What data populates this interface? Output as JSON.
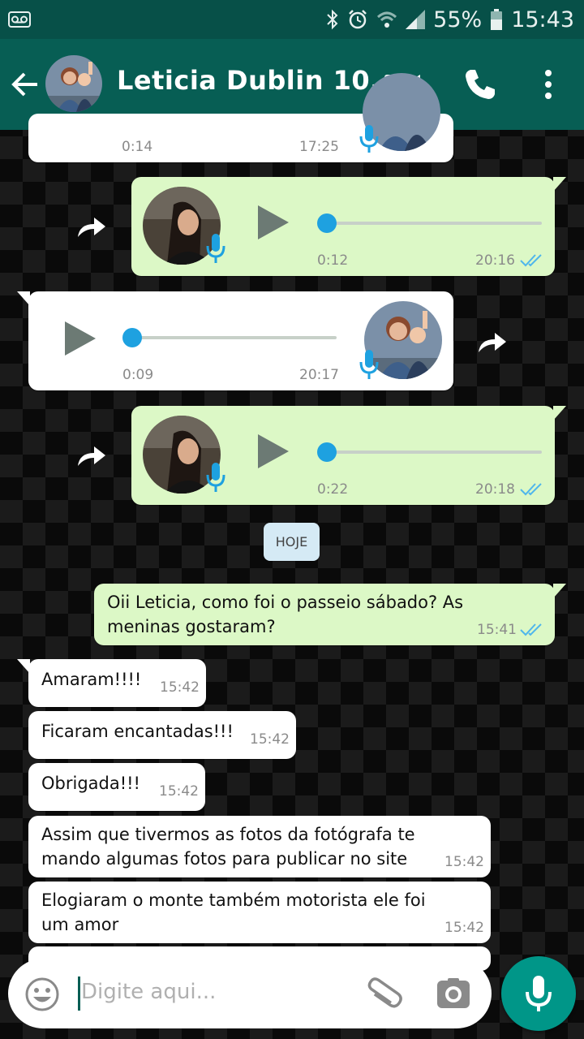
{
  "status_bar": {
    "battery": "55%",
    "time": "15:43"
  },
  "header": {
    "contact_name": "Leticia Dublin 10..."
  },
  "messages": {
    "m0": {
      "duration": "0:14",
      "time": "17:25"
    },
    "m1": {
      "duration": "0:12",
      "time": "20:16"
    },
    "m2": {
      "duration": "0:09",
      "time": "20:17"
    },
    "m3": {
      "duration": "0:22",
      "time": "20:18"
    },
    "date_divider": "HOJE",
    "m4": {
      "text": "Oii Leticia, como foi o passeio sábado? As meninas gostaram?",
      "time": "15:41"
    },
    "m5": {
      "text": "Amaram!!!!",
      "time": "15:42"
    },
    "m6": {
      "text": "Ficaram encantadas!!!",
      "time": "15:42"
    },
    "m7": {
      "text": "Obrigada!!!",
      "time": "15:42"
    },
    "m8": {
      "text": "Assim que tivermos as fotos da fotógrafa te mando algumas fotos para publicar no site",
      "time": "15:42"
    },
    "m9": {
      "text": "Elogiaram o monte também motorista ele foi um amor",
      "time": "15:42"
    }
  },
  "composer": {
    "placeholder": "Digite aqui..."
  },
  "colors": {
    "header": "#075e54",
    "outgoing": "#dcf8c6",
    "incoming": "#ffffff",
    "accent": "#1ea1e0",
    "mic_button": "#009688"
  },
  "icons": [
    "voicemail-icon",
    "bluetooth-icon",
    "alarm-icon",
    "wifi-icon",
    "signal-icon",
    "battery-icon",
    "back-arrow-icon",
    "video-call-icon",
    "phone-icon",
    "more-vert-icon",
    "forward-icon",
    "play-icon",
    "mic-icon",
    "double-check-icon",
    "emoji-icon",
    "attach-icon",
    "camera-icon"
  ]
}
